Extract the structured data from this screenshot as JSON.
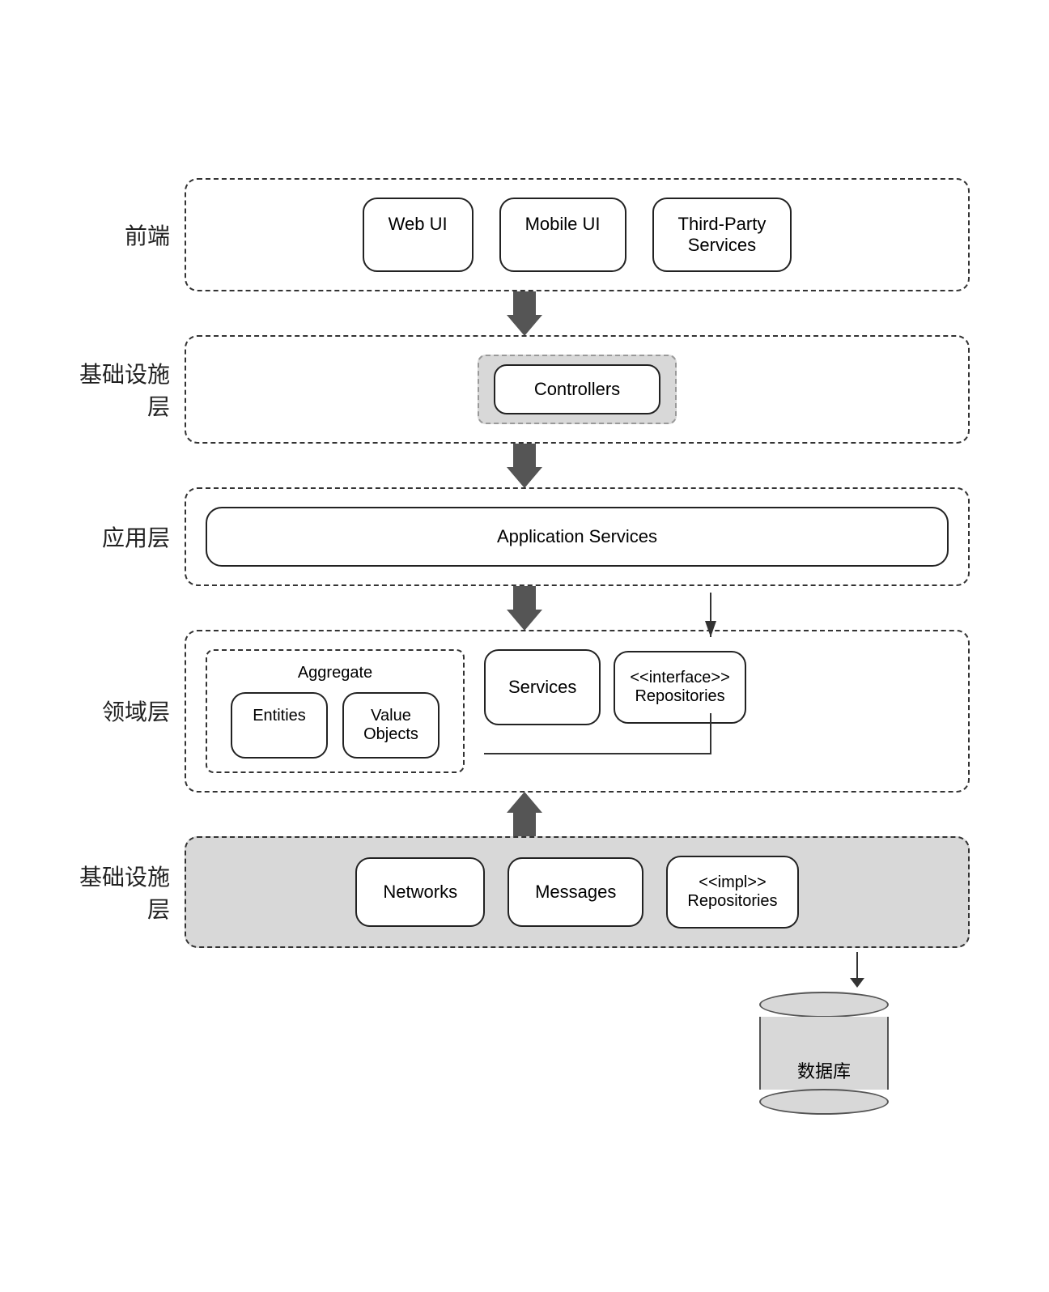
{
  "layers": {
    "frontend": {
      "label": "前端",
      "boxes": [
        "Web UI",
        "Mobile UI",
        "Third-Party\nServices"
      ]
    },
    "infra_top": {
      "label": "基础设施层",
      "controller": "Controllers"
    },
    "application": {
      "label": "应用层",
      "service": "Application Services"
    },
    "domain": {
      "label": "领域层",
      "aggregate_label": "Aggregate",
      "entities": "Entities",
      "value_objects": "Value\nObjects",
      "services": "Services",
      "repositories": "<<interface>>\nRepositories"
    },
    "infra_bottom": {
      "label": "基础设施层",
      "networks": "Networks",
      "messages": "Messages",
      "impl_repositories": "<<impl>>\nRepositories"
    },
    "database": {
      "label": "数据库"
    }
  }
}
